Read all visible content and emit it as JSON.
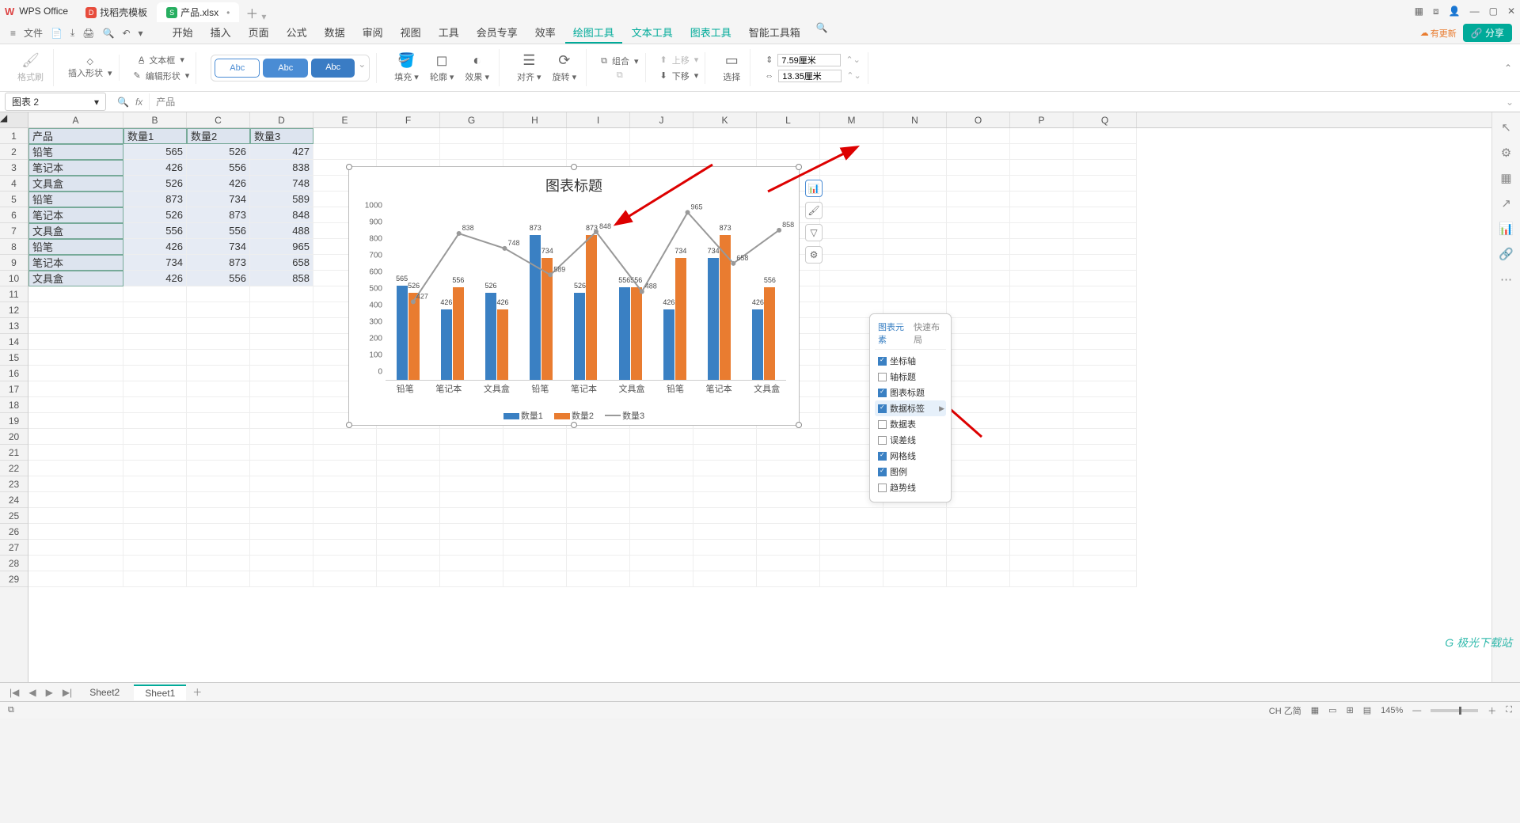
{
  "titlebar": {
    "app": "WPS Office",
    "tab_template": "找稻壳模板",
    "tab_file": "产品.xlsx",
    "add_tab": "＋"
  },
  "window_ctrl": {
    "min": "—",
    "max": "▢",
    "close": "✕"
  },
  "menubar": {
    "file": "文件",
    "icons": [
      "⎙",
      "⤓",
      "🖨",
      "⎌",
      "↷"
    ],
    "items": [
      "开始",
      "插入",
      "页面",
      "公式",
      "数据",
      "审阅",
      "视图",
      "工具",
      "会员专享",
      "效率",
      "绘图工具",
      "文本工具",
      "图表工具",
      "智能工具箱"
    ],
    "active": "绘图工具",
    "update": "有更新",
    "share": "分享"
  },
  "ribbon": {
    "format_painter": "格式刷",
    "insert_shape": "插入形状",
    "text_box": "文本框",
    "edit_shape": "编辑形状",
    "style_label": "Abc",
    "fill": "填充",
    "outline": "轮廓",
    "effect": "效果",
    "align": "对齐",
    "rotate": "旋转",
    "group": "组合",
    "up": "上移",
    "down": "下移",
    "select": "选择",
    "h_label": "7.59厘米",
    "w_label": "13.35厘米"
  },
  "namebox": "图表 2",
  "formula_text": "产品",
  "columns": [
    "A",
    "B",
    "C",
    "D",
    "E",
    "F",
    "G",
    "H",
    "I",
    "J",
    "K",
    "L",
    "M",
    "N",
    "O",
    "P",
    "Q"
  ],
  "row_count": 29,
  "table": {
    "header": [
      "产品",
      "数量1",
      "数量2",
      "数量3"
    ],
    "rows": [
      [
        "铅笔",
        565,
        526,
        427
      ],
      [
        "笔记本",
        426,
        556,
        838
      ],
      [
        "文具盒",
        526,
        426,
        748
      ],
      [
        "铅笔",
        873,
        734,
        589
      ],
      [
        "笔记本",
        526,
        873,
        848
      ],
      [
        "文具盒",
        556,
        556,
        488
      ],
      [
        "铅笔",
        426,
        734,
        965
      ],
      [
        "笔记本",
        734,
        873,
        658
      ],
      [
        "文具盒",
        426,
        556,
        858
      ]
    ]
  },
  "chart_data": {
    "type": "bar",
    "title": "图表标题",
    "categories": [
      "铅笔",
      "笔记本",
      "文具盒",
      "铅笔",
      "笔记本",
      "文具盒",
      "铅笔",
      "笔记本",
      "文具盒"
    ],
    "series": [
      {
        "name": "数量1",
        "values": [
          565,
          426,
          526,
          873,
          526,
          556,
          426,
          734,
          426
        ],
        "kind": "bar",
        "color": "#3a80c3"
      },
      {
        "name": "数量2",
        "values": [
          526,
          556,
          426,
          734,
          873,
          556,
          734,
          873,
          556
        ],
        "kind": "bar",
        "color": "#e97c30"
      },
      {
        "name": "数量3",
        "values": [
          427,
          838,
          748,
          589,
          848,
          488,
          965,
          658,
          858
        ],
        "kind": "line",
        "color": "#999"
      }
    ],
    "ylim": [
      0,
      1000
    ],
    "ytick_step": 100
  },
  "chart_side": {
    "elements": "图表元素",
    "brush": "样式",
    "filter": "筛选",
    "settings": "设置"
  },
  "elem_popup": {
    "tab1": "图表元素",
    "tab2": "快速布局",
    "opts": [
      {
        "label": "坐标轴",
        "checked": true
      },
      {
        "label": "轴标题",
        "checked": false
      },
      {
        "label": "图表标题",
        "checked": true
      },
      {
        "label": "数据标签",
        "checked": true,
        "hl": true,
        "arrow": true
      },
      {
        "label": "数据表",
        "checked": false
      },
      {
        "label": "误差线",
        "checked": false
      },
      {
        "label": "网格线",
        "checked": true
      },
      {
        "label": "图例",
        "checked": true
      },
      {
        "label": "趋势线",
        "checked": false
      }
    ]
  },
  "sheet_tabs": {
    "tabs": [
      "Sheet2",
      "Sheet1"
    ],
    "active": "Sheet1",
    "add": "＋"
  },
  "status": {
    "lang": "CH 乙简",
    "zoom": "145%",
    "add": "＋",
    "sub": "—"
  },
  "watermark": "极光下载站"
}
